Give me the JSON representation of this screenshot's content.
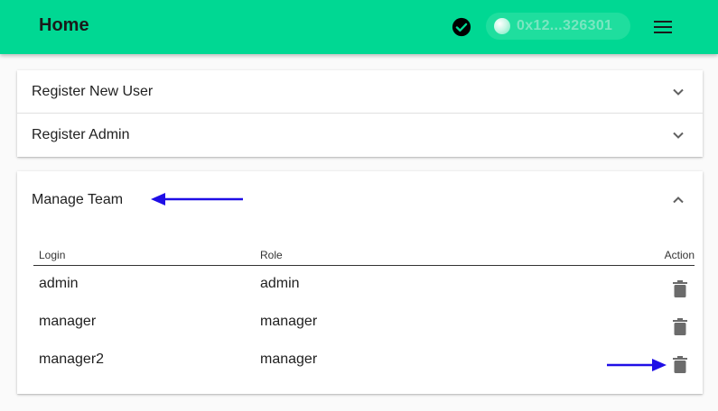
{
  "appbar": {
    "title": "Home",
    "status_icon": "check-circle-icon",
    "wallet_address": "0x12...326301",
    "menu_icon": "hamburger-menu-icon",
    "background_color": "#00d893"
  },
  "panels": {
    "register_user": {
      "label": "Register New User",
      "icon": "chevron-down-icon"
    },
    "register_admin": {
      "label": "Register Admin",
      "icon": "chevron-down-icon"
    },
    "manage_team": {
      "label": "Manage Team",
      "icon": "chevron-up-icon"
    }
  },
  "team_table": {
    "headers": {
      "login": "Login",
      "role": "Role",
      "action": "Action"
    },
    "rows": [
      {
        "login": "admin",
        "role": "admin",
        "action_icon": "trash-icon"
      },
      {
        "login": "manager",
        "role": "manager",
        "action_icon": "trash-icon"
      },
      {
        "login": "manager2",
        "role": "manager",
        "action_icon": "trash-icon"
      }
    ]
  },
  "annotations": {
    "arrow_color": "#1f0ee6"
  }
}
